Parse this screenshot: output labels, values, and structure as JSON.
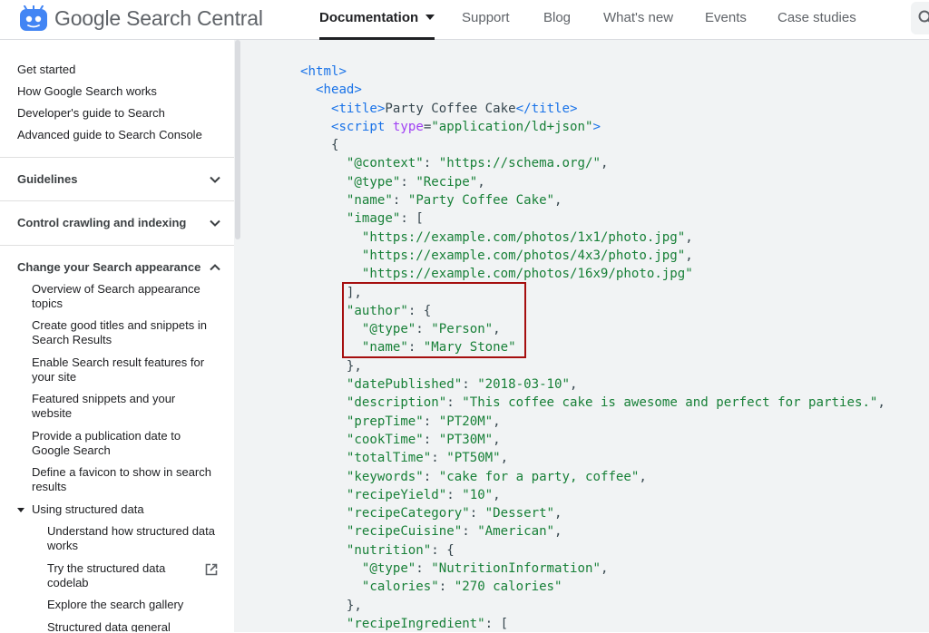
{
  "header": {
    "brand": "Google Search Central",
    "nav": [
      {
        "label": "Documentation"
      },
      {
        "label": "Support"
      },
      {
        "label": "Blog"
      },
      {
        "label": "What's new"
      },
      {
        "label": "Events"
      },
      {
        "label": "Case studies"
      }
    ]
  },
  "sidebar": {
    "top_links": [
      "Get started",
      "How Google Search works",
      "Developer's guide to Search",
      "Advanced guide to Search Console"
    ],
    "sections": [
      "Guidelines",
      "Control crawling and indexing",
      "Change your Search appearance"
    ],
    "appearance_items": [
      "Overview of Search appearance topics",
      "Create good titles and snippets in Search Results",
      "Enable Search result features for your site",
      "Featured snippets and your website",
      "Provide a publication date to Google Search",
      "Define a favicon to show in search results"
    ],
    "structured_group": "Using structured data",
    "structured_items": [
      "Understand how structured data works",
      "Try the structured data codelab",
      "Explore the search gallery",
      "Structured data general"
    ]
  },
  "code": {
    "lines": [
      "<html>",
      "  <head>",
      "    <title>Party Coffee Cake</title>",
      "    <script type=\"application/ld+json\">",
      "    {",
      "      \"@context\": \"https://schema.org/\",",
      "      \"@type\": \"Recipe\",",
      "      \"name\": \"Party Coffee Cake\",",
      "      \"image\": [",
      "        \"https://example.com/photos/1x1/photo.jpg\",",
      "        \"https://example.com/photos/4x3/photo.jpg\",",
      "        \"https://example.com/photos/16x9/photo.jpg\"",
      "      ],",
      "      \"author\": {",
      "        \"@type\": \"Person\",",
      "        \"name\": \"Mary Stone\"",
      "      },",
      "      \"datePublished\": \"2018-03-10\",",
      "      \"description\": \"This coffee cake is awesome and perfect for parties.\",",
      "      \"prepTime\": \"PT20M\",",
      "      \"cookTime\": \"PT30M\",",
      "      \"totalTime\": \"PT50M\",",
      "      \"keywords\": \"cake for a party, coffee\",",
      "      \"recipeYield\": \"10\",",
      "      \"recipeCategory\": \"Dessert\",",
      "      \"recipeCuisine\": \"American\",",
      "      \"nutrition\": {",
      "        \"@type\": \"NutritionInformation\",",
      "        \"calories\": \"270 calories\"",
      "      },",
      "      \"recipeIngredient\": ["
    ]
  },
  "colors": {
    "tag": "#1a73e8",
    "attribute": "#a142f4",
    "string": "#188038",
    "highlight_border": "#a50e0e",
    "code_background": "#f1f3f4"
  }
}
